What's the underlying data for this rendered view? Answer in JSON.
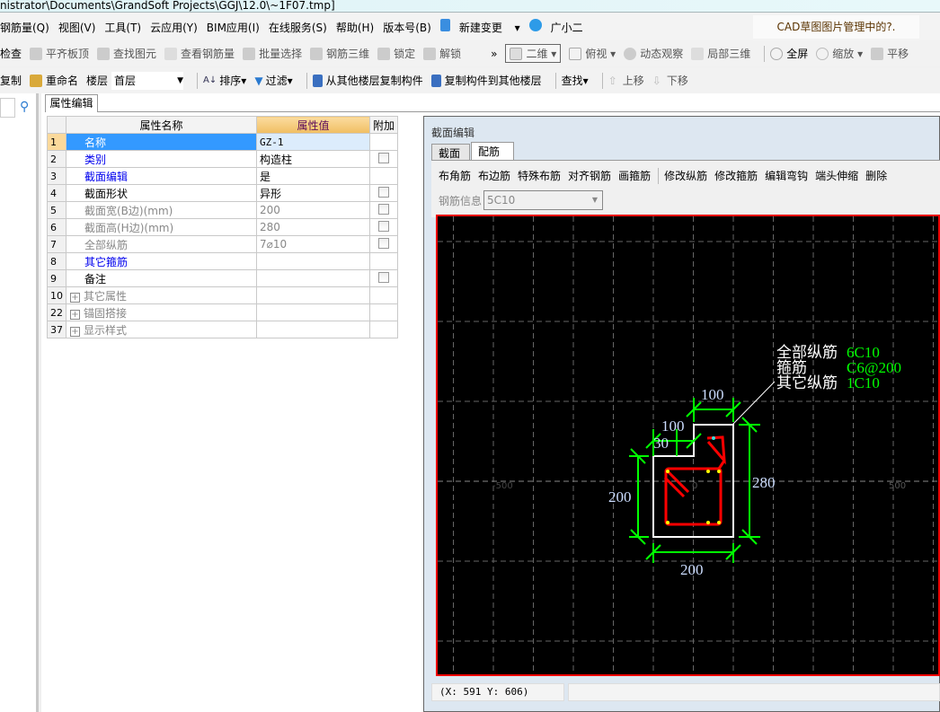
{
  "window": {
    "title": "nistrator\\Documents\\GrandSoft Projects\\GGJ\\12.0\\~1F07.tmp]"
  },
  "menu": [
    "钢筋量(Q)",
    "视图(V)",
    "工具(T)",
    "云应用(Y)",
    "BIM应用(I)",
    "在线服务(S)",
    "帮助(H)",
    "版本号(B)",
    "新建变更",
    "广小二"
  ],
  "cad_notice": "CAD草图图片管理中的?.",
  "toolbar1": {
    "items": [
      "检查",
      "平齐板顶",
      "查找图元",
      "查看钢筋量",
      "批量选择",
      "钢筋三维",
      "锁定",
      "解锁"
    ],
    "view_mode": "二维",
    "right_items": [
      "俯视",
      "动态观察",
      "局部三维",
      "全屏",
      "缩放",
      "平移"
    ]
  },
  "toolbar2": {
    "copy": "复制",
    "rename": "重命名",
    "floor_label": "楼层",
    "floor_value": "首层",
    "sort": "排序",
    "filter": "过滤",
    "copy_from": "从其他楼层复制构件",
    "copy_to": "复制构件到其他楼层",
    "find": "查找",
    "move_up": "上移",
    "move_down": "下移"
  },
  "props": {
    "tab": "属性编辑",
    "headers": [
      "属性名称",
      "属性值",
      "附加"
    ],
    "rows": [
      {
        "n": "1",
        "name": "名称",
        "value": "GZ-1",
        "check": false,
        "style": "sel"
      },
      {
        "n": "2",
        "name": "类别",
        "value": "构造柱",
        "check": true,
        "style": "blue"
      },
      {
        "n": "3",
        "name": "截面编辑",
        "value": "是",
        "check": false,
        "style": "blue"
      },
      {
        "n": "4",
        "name": "截面形状",
        "value": "异形",
        "check": true,
        "style": ""
      },
      {
        "n": "5",
        "name": "截面宽(B边)(mm)",
        "value": "200",
        "check": true,
        "style": "grey"
      },
      {
        "n": "6",
        "name": "截面高(H边)(mm)",
        "value": "280",
        "check": true,
        "style": "grey"
      },
      {
        "n": "7",
        "name": "全部纵筋",
        "value": "7⌀10",
        "check": true,
        "style": "grey"
      },
      {
        "n": "8",
        "name": "其它箍筋",
        "value": "",
        "check": false,
        "style": "blue"
      },
      {
        "n": "9",
        "name": "备注",
        "value": "",
        "check": true,
        "style": ""
      },
      {
        "n": "10",
        "name": "其它属性",
        "value": "",
        "check": false,
        "style": "grey",
        "group": true
      },
      {
        "n": "22",
        "name": "锚固搭接",
        "value": "",
        "check": false,
        "style": "grey",
        "group": true
      },
      {
        "n": "37",
        "name": "显示样式",
        "value": "",
        "check": false,
        "style": "grey",
        "group": true
      }
    ]
  },
  "section_editor": {
    "title": "截面编辑",
    "tabs": [
      "截面",
      "配筋"
    ],
    "active_tab": "配筋",
    "tools": [
      "布角筋",
      "布边筋",
      "特殊布筋",
      "对齐钢筋",
      "画箍筋",
      "修改纵筋",
      "修改箍筋",
      "编辑弯钩",
      "端头伸缩",
      "删除"
    ],
    "rebar_info_label": "钢筋信息",
    "rebar_info_value": "5C10",
    "drawing": {
      "labels": [
        {
          "k": "全部纵筋",
          "v": "6C10"
        },
        {
          "k": "箍筋",
          "v": "C6@200"
        },
        {
          "k": "其它纵筋",
          "v": "1C10"
        }
      ],
      "dims": [
        "100",
        "100",
        "30",
        "200",
        "280",
        "200"
      ],
      "axis": [
        "-500",
        "0",
        "500"
      ]
    },
    "status": "(X: 591 Y: 606)"
  },
  "colors": {
    "dim": "#00ff00",
    "rebar": "#ff0000",
    "outline": "#ffffff",
    "label_value": "#00ff00",
    "highlight": "#3399ff",
    "header_value": "#f3c875"
  }
}
